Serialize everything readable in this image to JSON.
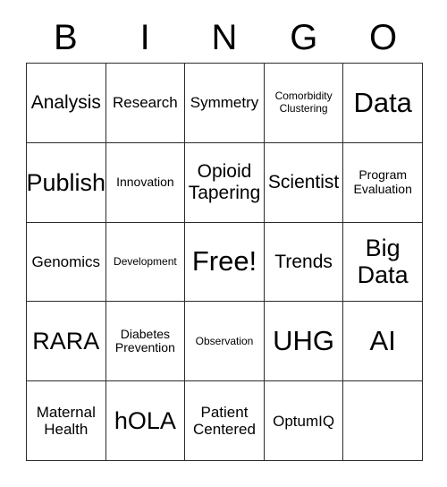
{
  "card": {
    "title": "BINGO",
    "header_letters": [
      "B",
      "I",
      "N",
      "G",
      "O"
    ],
    "grid": {
      "rows": 5,
      "columns": 5,
      "border_color": "#2b2b2b",
      "background_color": "#ffffff",
      "text_color": "#000000"
    },
    "cells": [
      {
        "text": "Analysis",
        "size": "sz-l",
        "empty": false
      },
      {
        "text": "Research",
        "size": "sz-m",
        "empty": false
      },
      {
        "text": "Symmetry",
        "size": "sz-m",
        "empty": false
      },
      {
        "text": "Comorbidity\nClustering",
        "size": "sz-xs",
        "empty": false
      },
      {
        "text": "Data",
        "size": "sz-xxl",
        "empty": false
      },
      {
        "text": "Publish",
        "size": "sz-xl",
        "empty": false
      },
      {
        "text": "Innovation",
        "size": "sz-s",
        "empty": false
      },
      {
        "text": "Opioid\nTapering",
        "size": "sz-l",
        "empty": false
      },
      {
        "text": "Scientist",
        "size": "sz-l",
        "empty": false
      },
      {
        "text": "Program\nEvaluation",
        "size": "sz-s",
        "empty": false
      },
      {
        "text": "Genomics",
        "size": "sz-m",
        "empty": false
      },
      {
        "text": "Development",
        "size": "sz-xs",
        "empty": false
      },
      {
        "text": "Free!",
        "size": "sz-xxl",
        "empty": false
      },
      {
        "text": "Trends",
        "size": "sz-l",
        "empty": false
      },
      {
        "text": "Big\nData",
        "size": "sz-xl",
        "empty": false
      },
      {
        "text": "RARA",
        "size": "sz-xl",
        "empty": false
      },
      {
        "text": "Diabetes\nPrevention",
        "size": "sz-s",
        "empty": false
      },
      {
        "text": "Observation",
        "size": "sz-xs",
        "empty": false
      },
      {
        "text": "UHG",
        "size": "sz-xxl",
        "empty": false
      },
      {
        "text": "AI",
        "size": "sz-xxl",
        "empty": false
      },
      {
        "text": "Maternal\nHealth",
        "size": "sz-m",
        "empty": false
      },
      {
        "text": "hOLA",
        "size": "sz-xl",
        "empty": false
      },
      {
        "text": "Patient\nCentered",
        "size": "sz-m",
        "empty": false
      },
      {
        "text": "OptumIQ",
        "size": "sz-m",
        "empty": false
      },
      {
        "text": "",
        "size": "sz-m",
        "empty": true
      }
    ]
  }
}
